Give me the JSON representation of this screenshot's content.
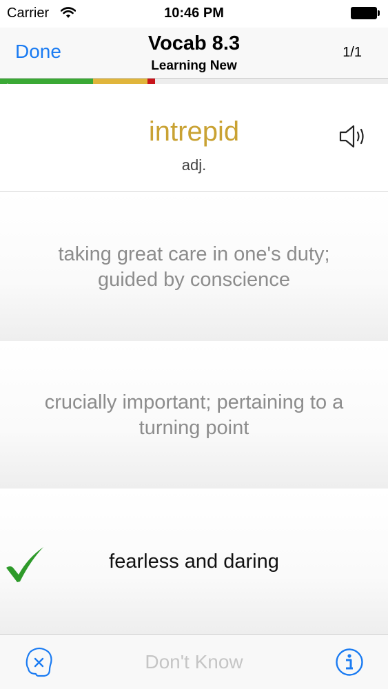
{
  "status_bar": {
    "carrier": "Carrier",
    "time": "10:46 PM"
  },
  "nav": {
    "done_label": "Done",
    "title": "Vocab 8.3",
    "subtitle": "Learning New",
    "count": "1/1"
  },
  "progress": {
    "segments": [
      {
        "status": "known",
        "fraction": 0.24,
        "color": "#3aa935"
      },
      {
        "status": "learning",
        "fraction": 0.14,
        "color": "#e0b53b"
      },
      {
        "status": "missed",
        "fraction": 0.02,
        "color": "#c8151b"
      }
    ]
  },
  "card": {
    "term": "intrepid",
    "part_of_speech": "adj.",
    "term_color": "#c9a233"
  },
  "choices": [
    {
      "lines": [
        "taking great care in one's duty;",
        "guided by conscience"
      ],
      "state": "dimmed"
    },
    {
      "lines": [
        "crucially important; pertaining to a",
        "turning point"
      ],
      "state": "dimmed"
    },
    {
      "lines": [
        "fearless and daring"
      ],
      "state": "correct"
    }
  ],
  "toolbar": {
    "dont_know_label": "Don't Know"
  },
  "icons": {
    "speaker": "speaker-icon",
    "check": "checkmark-icon",
    "skip": "dont-know-face-icon",
    "info": "info-icon"
  },
  "colors": {
    "accent": "#1a7bf2",
    "correct": "#2e9a2a"
  }
}
